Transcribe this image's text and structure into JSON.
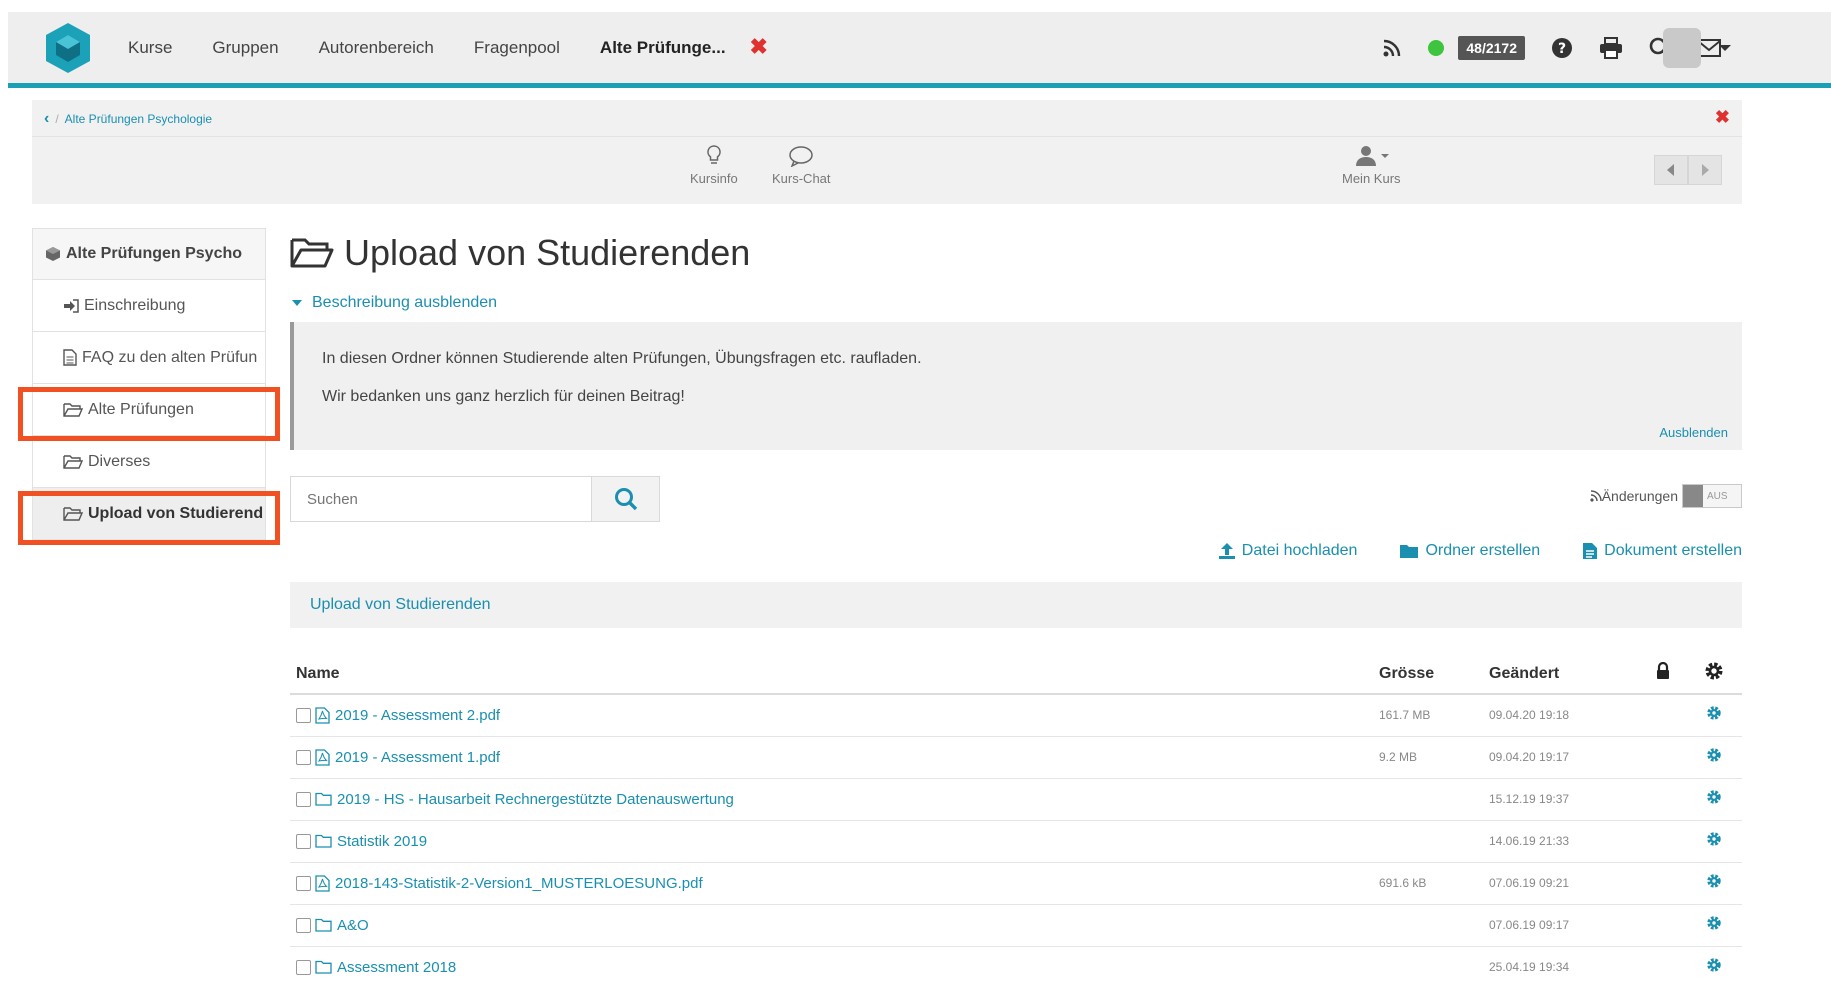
{
  "nav": {
    "items": [
      "Kurse",
      "Gruppen",
      "Autorenbereich",
      "Fragenpool"
    ],
    "active_tab": "Alte Prüfunge...",
    "close_symbol": "✖",
    "counter": "48/2172",
    "online_status_color": "#3ec43e"
  },
  "breadcrumb": {
    "back_symbol": "‹",
    "separator": "/",
    "text": "Alte Prüfungen Psychologie",
    "close_symbol": "✖"
  },
  "course_toolbar": {
    "kursinfo": "Kursinfo",
    "kurs_chat": "Kurs-Chat",
    "mein_kurs": "Mein Kurs"
  },
  "sidebar": {
    "root": "Alte Prüfungen Psycho",
    "items": [
      {
        "label": "Einschreibung",
        "icon": "sign-in-icon"
      },
      {
        "label": "FAQ zu den alten Prüfun",
        "icon": "document-icon"
      },
      {
        "label": "Alte Prüfungen",
        "icon": "folder-open-icon"
      },
      {
        "label": "Diverses",
        "icon": "folder-open-icon"
      },
      {
        "label": "Upload von Studierend",
        "icon": "folder-open-icon"
      }
    ]
  },
  "main": {
    "title": "Upload von Studierenden",
    "toggle_description": "Beschreibung ausblenden",
    "description_lines": [
      "In diesen Ordner können Studierende alten Prüfungen, Übungsfragen etc. raufladen.",
      "Wir bedanken uns ganz herzlich für deinen Beitrag!"
    ],
    "hide_link": "Ausblenden",
    "search_placeholder": "Suchen",
    "rss_label": "Änderungen",
    "rss_switch": "AUS",
    "actions": {
      "upload": "Datei hochladen",
      "create_folder": "Ordner erstellen",
      "create_document": "Dokument erstellen"
    },
    "folder_path": "Upload von Studierenden"
  },
  "table": {
    "headers": {
      "name": "Name",
      "size": "Grösse",
      "changed": "Geändert"
    },
    "rows": [
      {
        "name": "2019 - Assessment 2.pdf",
        "type": "pdf",
        "size": "161.7 MB",
        "changed": "09.04.20 19:18"
      },
      {
        "name": "2019 - Assessment 1.pdf",
        "type": "pdf",
        "size": "9.2 MB",
        "changed": "09.04.20 19:17"
      },
      {
        "name": "2019 - HS - Hausarbeit Rechnergestützte Datenauswertung",
        "type": "folder",
        "size": "",
        "changed": "15.12.19 19:37"
      },
      {
        "name": "Statistik 2019",
        "type": "folder",
        "size": "",
        "changed": "14.06.19 21:33"
      },
      {
        "name": "2018-143-Statistik-2-Version1_MUSTERLOESUNG.pdf",
        "type": "pdf",
        "size": "691.6 kB",
        "changed": "07.06.19 09:21"
      },
      {
        "name": "A&O",
        "type": "folder",
        "size": "",
        "changed": "07.06.19 09:17"
      },
      {
        "name": "Assessment 2018",
        "type": "folder",
        "size": "",
        "changed": "25.04.19 19:34"
      }
    ]
  }
}
